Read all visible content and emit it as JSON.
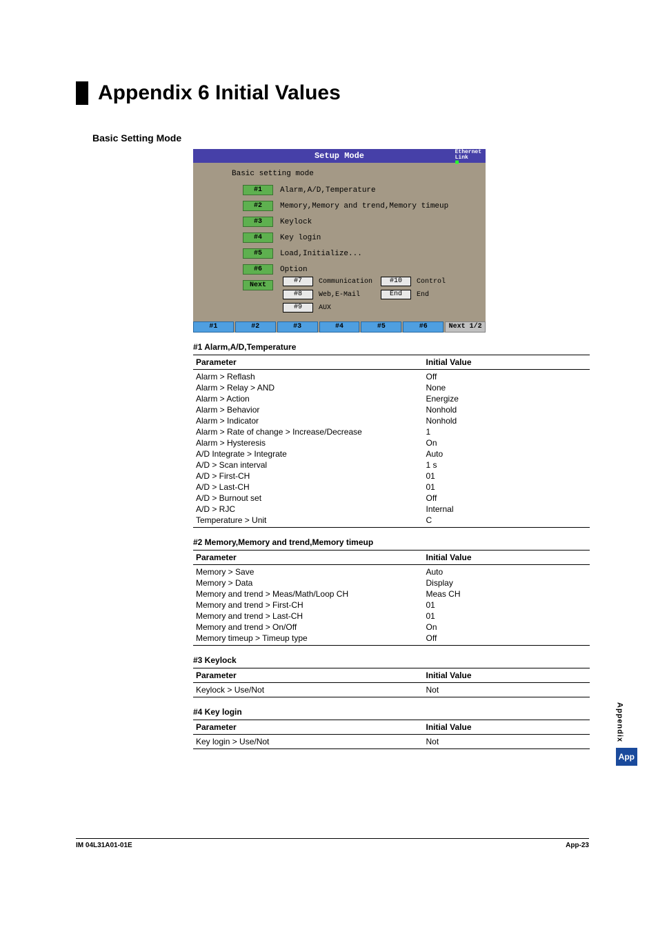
{
  "chapter": {
    "title": "Appendix 6  Initial Values"
  },
  "section": {
    "heading": "Basic Setting Mode"
  },
  "screenshot": {
    "title": "Setup Mode",
    "ethernet": "Ethernet\nLink",
    "mode_label": "Basic setting mode",
    "menu": [
      {
        "tag": "#1",
        "text": "Alarm,A/D,Temperature"
      },
      {
        "tag": "#2",
        "text": "Memory,Memory and trend,Memory timeup"
      },
      {
        "tag": "#3",
        "text": "Keylock"
      },
      {
        "tag": "#4",
        "text": "Key login"
      },
      {
        "tag": "#5",
        "text": "Load,Initialize..."
      },
      {
        "tag": "#6",
        "text": "Option"
      },
      {
        "tag": "Next",
        "text": ""
      }
    ],
    "submenu": [
      {
        "tag": "#7",
        "text": "Communication",
        "tag2": "#10",
        "text2": "Control"
      },
      {
        "tag": "#8",
        "text": "Web,E-Mail",
        "tag2": "End",
        "text2": "End"
      },
      {
        "tag": "#9",
        "text": "AUX",
        "tag2": "",
        "text2": ""
      }
    ],
    "softkeys": [
      "#1",
      "#2",
      "#3",
      "#4",
      "#5",
      "#6",
      "Next 1/2"
    ]
  },
  "tables": [
    {
      "title": "#1 Alarm,A/D,Temperature",
      "rows": [
        [
          "Alarm > Reflash",
          "Off"
        ],
        [
          "Alarm > Relay > AND",
          "None"
        ],
        [
          "Alarm > Action",
          "Energize"
        ],
        [
          "Alarm > Behavior",
          "Nonhold"
        ],
        [
          "Alarm > Indicator",
          "Nonhold"
        ],
        [
          "Alarm > Rate of change > Increase/Decrease",
          "1"
        ],
        [
          "Alarm > Hysteresis",
          "On"
        ],
        [
          "A/D Integrate > Integrate",
          "Auto"
        ],
        [
          "A/D > Scan interval",
          "1 s"
        ],
        [
          "A/D > First-CH",
          "01"
        ],
        [
          "A/D > Last-CH",
          "01"
        ],
        [
          "A/D > Burnout set",
          "Off"
        ],
        [
          "A/D > RJC",
          "Internal"
        ],
        [
          "Temperature > Unit",
          "C"
        ]
      ]
    },
    {
      "title": "#2 Memory,Memory and trend,Memory timeup",
      "rows": [
        [
          "Memory > Save",
          "Auto"
        ],
        [
          "Memory > Data",
          "Display"
        ],
        [
          "Memory and trend > Meas/Math/Loop CH",
          "Meas CH"
        ],
        [
          "Memory and trend > First-CH",
          "01"
        ],
        [
          "Memory and trend > Last-CH",
          "01"
        ],
        [
          "Memory and trend > On/Off",
          "On"
        ],
        [
          "Memory timeup > Timeup type",
          "Off"
        ]
      ]
    },
    {
      "title": "#3 Keylock",
      "rows": [
        [
          "Keylock > Use/Not",
          "Not"
        ]
      ]
    },
    {
      "title": "#4 Key login",
      "rows": [
        [
          "Key login > Use/Not",
          "Not"
        ]
      ]
    }
  ],
  "columns": {
    "param": "Parameter",
    "value": "Initial Value"
  },
  "footer": {
    "left": "IM 04L31A01-01E",
    "right": "App-23"
  },
  "side": {
    "label": "Appendix",
    "badge": "App"
  }
}
